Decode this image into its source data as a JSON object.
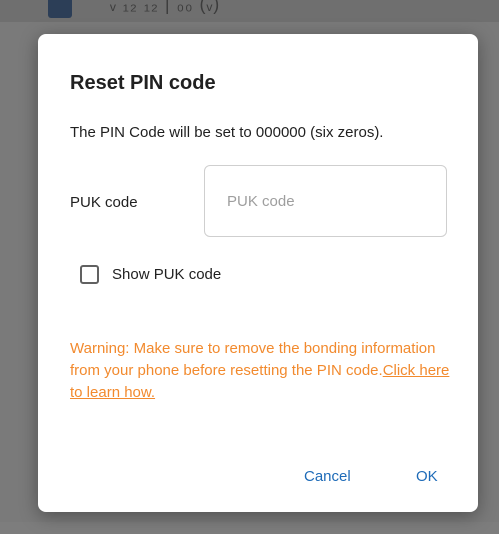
{
  "background": {
    "row_text": "ᵥ ₁₂ ₁₂ | ₀₀ (ᵥ)"
  },
  "dialog": {
    "title": "Reset PIN code",
    "message": "The PIN Code will be set to 000000 (six zeros).",
    "puk_field": {
      "label": "PUK code",
      "value": "",
      "placeholder": "PUK code"
    },
    "show_puk_checkbox": {
      "label": "Show PUK code",
      "checked": false
    },
    "warning": {
      "text": "Warning: Make sure to remove the bonding information from your phone before resetting the PIN code.",
      "link": "Click here to learn how."
    },
    "buttons": {
      "cancel": "Cancel",
      "ok": "OK"
    }
  },
  "colors": {
    "accent": "#1e6bb8",
    "warning": "#f28a2e",
    "scrim": "#7a7a7a"
  }
}
